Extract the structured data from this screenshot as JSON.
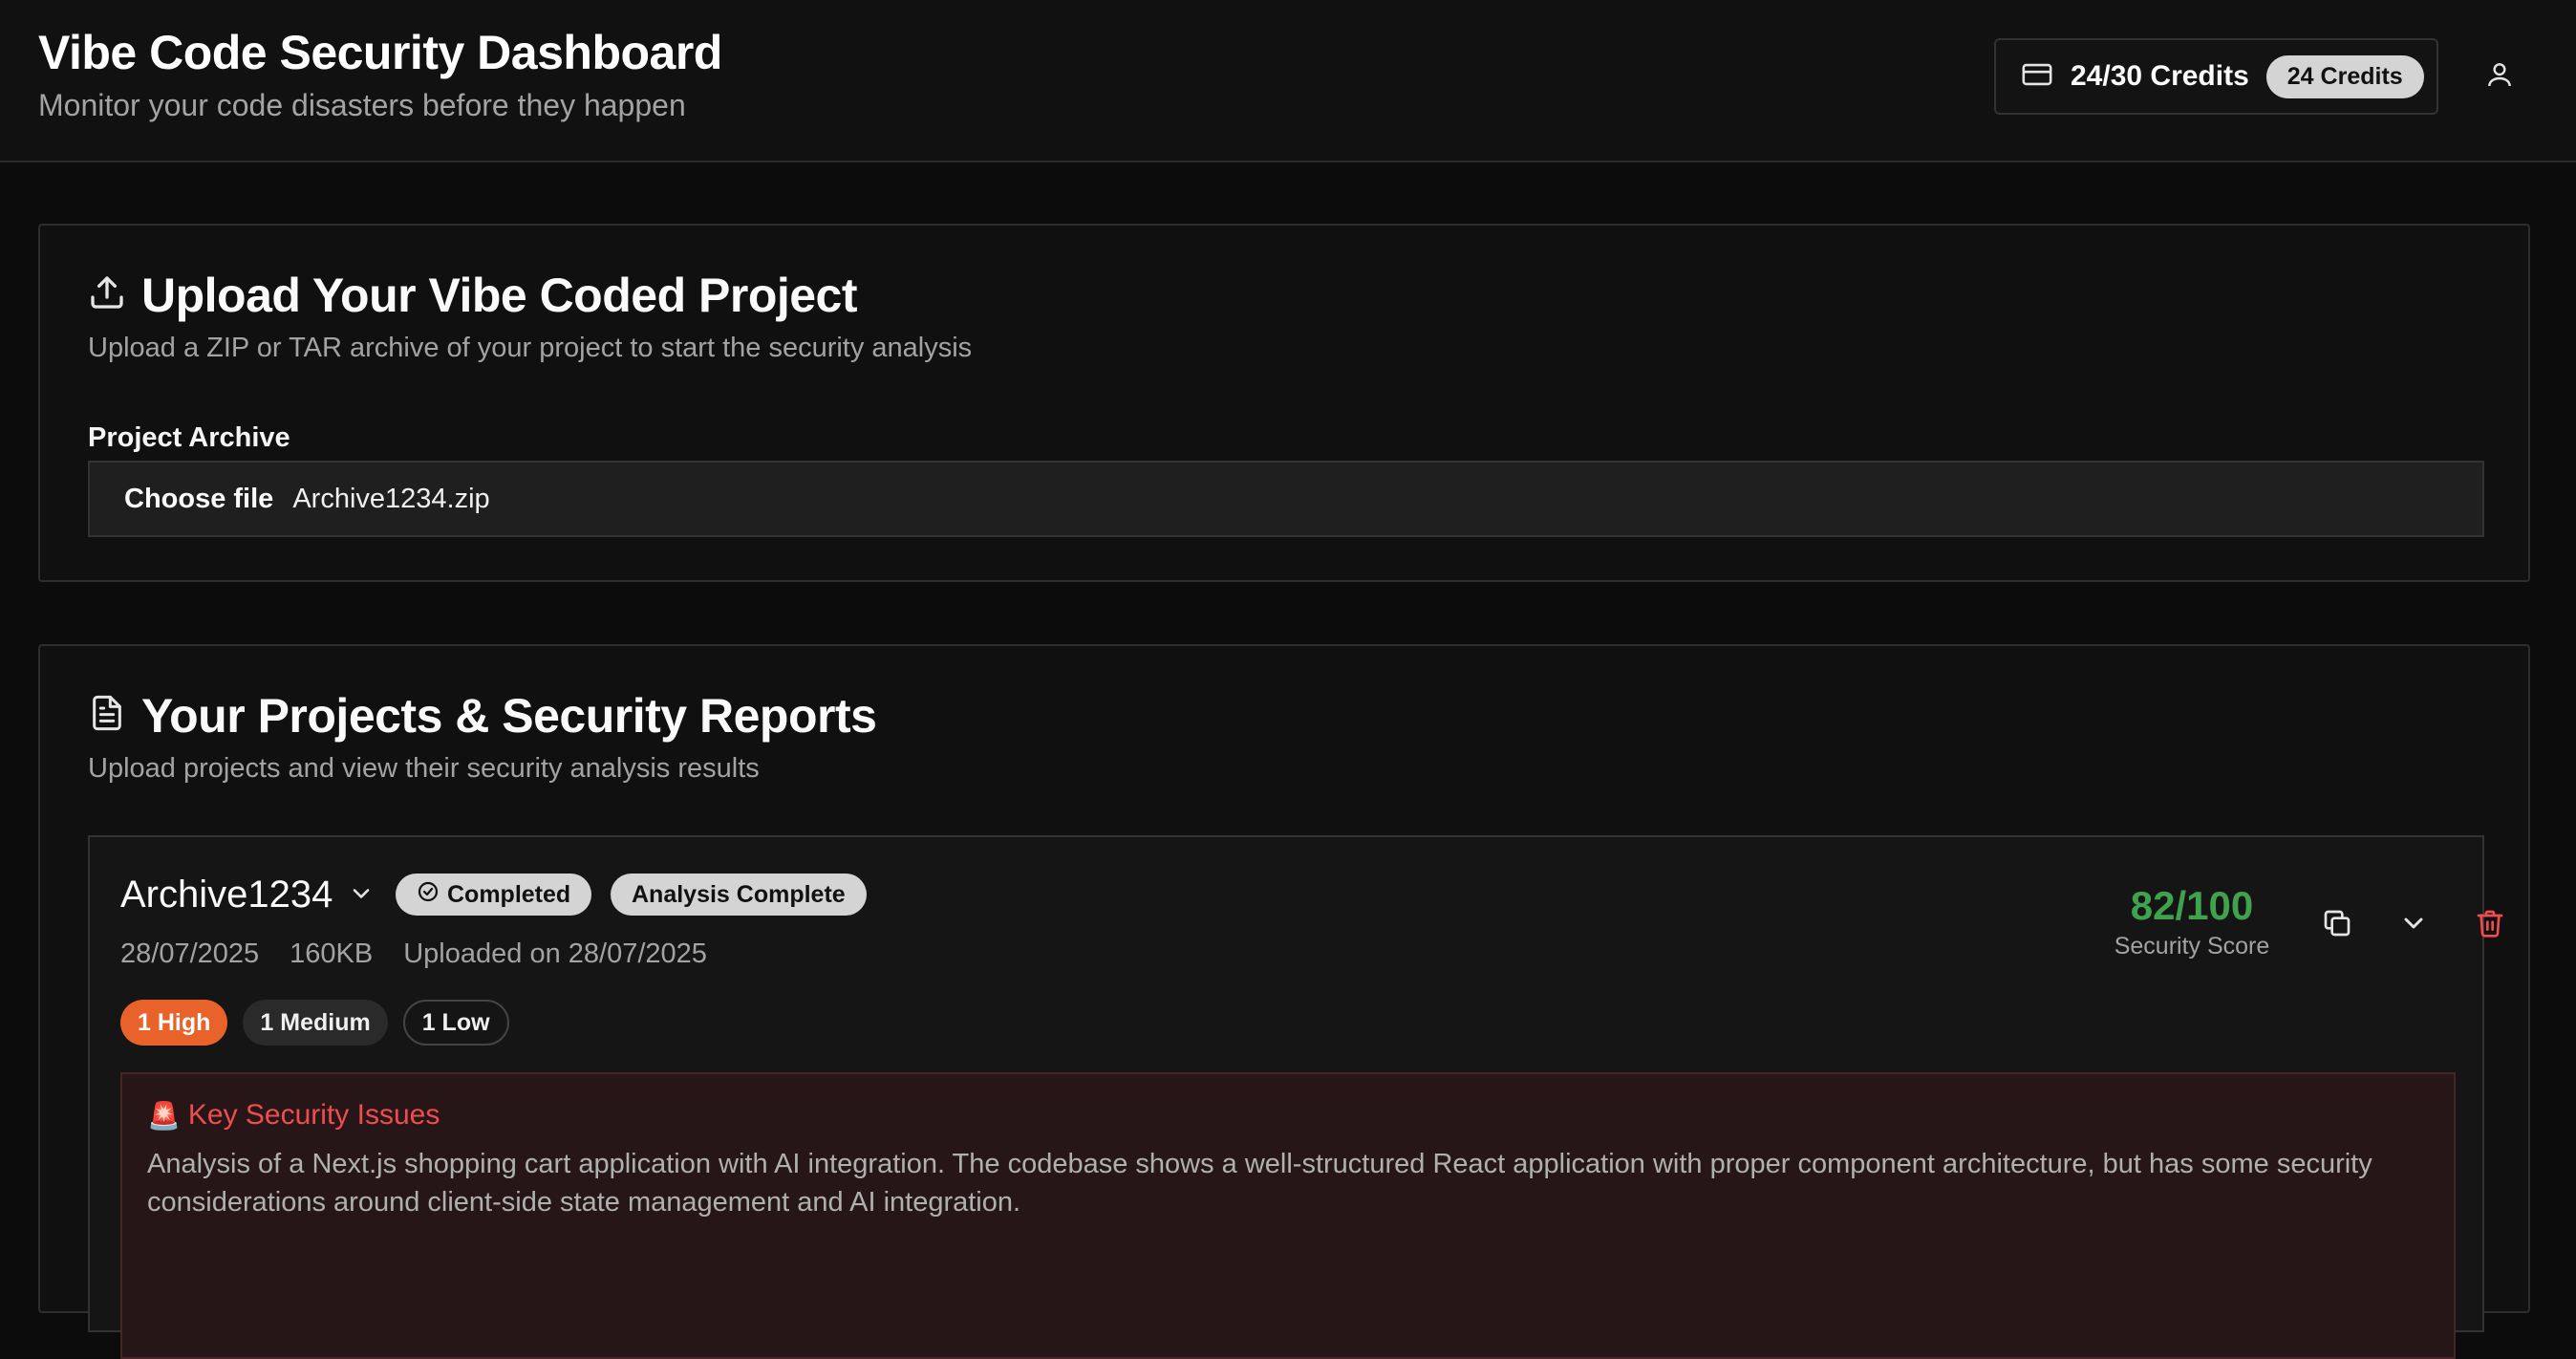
{
  "header": {
    "title": "Vibe Code Security Dashboard",
    "subtitle": "Monitor your code disasters before they happen",
    "credits_text": "24/30 Credits",
    "credits_badge": "24 Credits"
  },
  "upload": {
    "title": "Upload Your Vibe Coded Project",
    "description": "Upload a ZIP or TAR archive of your project to start the security analysis",
    "field_label": "Project Archive",
    "choose_file_label": "Choose file",
    "file_name": "Archive1234.zip"
  },
  "projects": {
    "title": "Your Projects & Security Reports",
    "description": "Upload projects and view their security analysis results",
    "items": [
      {
        "name": "Archive1234",
        "status": "Completed",
        "analysis_status": "Analysis Complete",
        "date": "28/07/2025",
        "size": "160KB",
        "uploaded": "Uploaded on 28/07/2025",
        "high": "1 High",
        "medium": "1 Medium",
        "low": "1 Low",
        "score": "82/100",
        "score_label": "Security Score",
        "issues_icon": "🚨",
        "issues_title": "Key Security Issues",
        "issues_text": "Analysis of a Next.js shopping cart application with AI integration. The codebase shows a well-structured React application with proper component architecture, but has some security considerations around client-side state management and AI integration."
      }
    ]
  },
  "colors": {
    "accent_green": "#3fa34d",
    "high_orange": "#e8622a",
    "danger_red": "#ef4d4d"
  }
}
